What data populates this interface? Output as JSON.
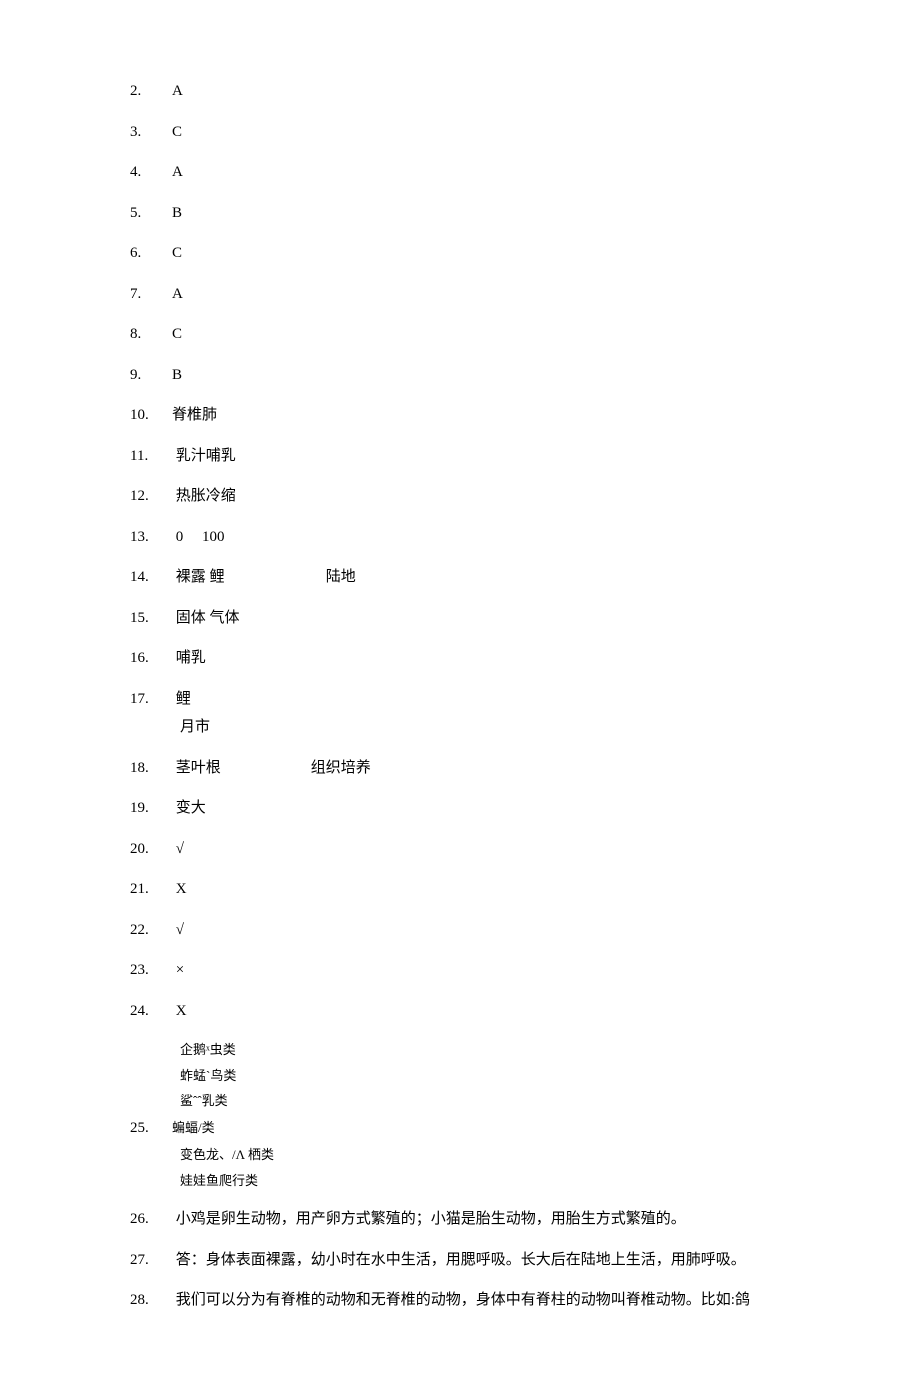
{
  "answers": {
    "q2": {
      "num": "2.",
      "text": "A"
    },
    "q3": {
      "num": "3.",
      "text": "C"
    },
    "q4": {
      "num": "4.",
      "text": "A"
    },
    "q5": {
      "num": "5.",
      "text": "B"
    },
    "q6": {
      "num": "6.",
      "text": "C"
    },
    "q7": {
      "num": "7.",
      "text": "A"
    },
    "q8": {
      "num": "8.",
      "text": "C"
    },
    "q9": {
      "num": "9.",
      "text": "B"
    },
    "q10": {
      "num": "10.",
      "text": "脊椎肺"
    },
    "q11": {
      "num": "11.",
      "text": " 乳汁哺乳"
    },
    "q12": {
      "num": "12.",
      "text": " 热胀冷缩"
    },
    "q13": {
      "num": "13.",
      "text": " 0     100"
    },
    "q14": {
      "num": "14.",
      "text": " 裸露 鲤                           陆地"
    },
    "q15": {
      "num": "15.",
      "text": " 固体 气体"
    },
    "q16": {
      "num": "16.",
      "text": " 哺乳"
    },
    "q17": {
      "num": "17.",
      "text": " 鲤"
    },
    "q17sub": "月市",
    "q18": {
      "num": "18.",
      "text": " 茎叶根                        组织培养"
    },
    "q19": {
      "num": "19.",
      "text": " 变大"
    },
    "q20": {
      "num": "20.",
      "text": " √"
    },
    "q21": {
      "num": "21.",
      "text": " X"
    },
    "q22": {
      "num": "22.",
      "text": " √"
    },
    "q23": {
      "num": "23.",
      "text": " ×"
    },
    "q24": {
      "num": "24.",
      "text": " X"
    },
    "q25": {
      "num": "25.",
      "lines": [
        "企鹅ˣ虫类",
        "蚱蜢ˋ鸟类",
        "鲨ˆˆ乳类",
        "蝙蝠/类",
        "变色龙、/Λ 栖类",
        "娃娃鱼爬行类"
      ]
    },
    "q26": {
      "num": "26.",
      "text": " 小鸡是卵生动物，用产卵方式繁殖的；小猫是胎生动物，用胎生方式繁殖的。"
    },
    "q27": {
      "num": "27.",
      "text": " 答：身体表面裸露，幼小时在水中生活，用腮呼吸。长大后在陆地上生活，用肺呼吸。"
    },
    "q28": {
      "num": "28.",
      "text": " 我们可以分为有脊椎的动物和无脊椎的动物，身体中有脊柱的动物叫脊椎动物。比如:鸽"
    }
  }
}
